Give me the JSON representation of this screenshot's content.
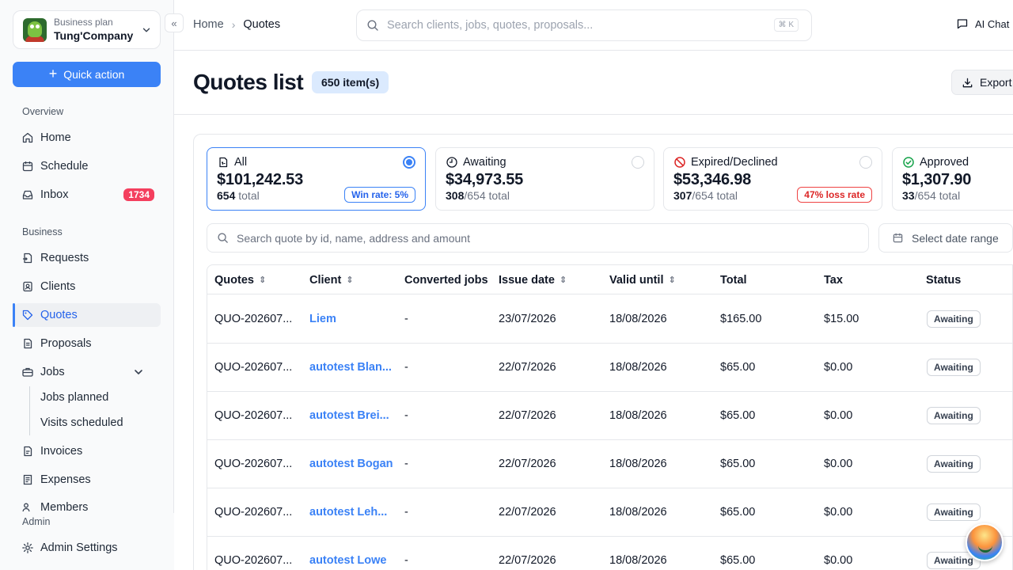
{
  "org": {
    "plan": "Business plan",
    "name": "Tung'Company"
  },
  "quick_action": "Quick action",
  "sidebar": {
    "overview_label": "Overview",
    "business_label": "Business",
    "admin_label": "Admin",
    "home": "Home",
    "schedule": "Schedule",
    "inbox": "Inbox",
    "inbox_count": "1734",
    "requests": "Requests",
    "clients": "Clients",
    "quotes": "Quotes",
    "proposals": "Proposals",
    "jobs": "Jobs",
    "jobs_planned": "Jobs planned",
    "visits_scheduled": "Visits scheduled",
    "invoices": "Invoices",
    "expenses": "Expenses",
    "members": "Members",
    "admin_settings": "Admin Settings"
  },
  "breadcrumb": {
    "home": "Home",
    "current": "Quotes"
  },
  "search": {
    "placeholder": "Search clients, jobs, quotes, proposals...",
    "shortcut": "⌘ K"
  },
  "ai_chat": "AI Chat",
  "page": {
    "title": "Quotes list",
    "count": "650 item(s)",
    "export": "Export"
  },
  "cards": [
    {
      "label": "All",
      "amount": "$101,242.53",
      "count": "654",
      "suffix": " total",
      "rate": "Win rate: 5%"
    },
    {
      "label": "Awaiting",
      "amount": "$34,973.55",
      "count": "308",
      "suffix": "/654 total"
    },
    {
      "label": "Expired/Declined",
      "amount": "$53,346.98",
      "count": "307",
      "suffix": "/654 total",
      "rate": "47% loss rate"
    },
    {
      "label": "Approved",
      "amount": "$1,307.90",
      "count": "33",
      "suffix": "/654 total"
    }
  ],
  "filters": {
    "search_placeholder": "Search quote by id, name, address and amount",
    "date_range": "Select date range"
  },
  "table": {
    "headers": {
      "quotes": "Quotes",
      "client": "Client",
      "converted": "Converted jobs",
      "issue": "Issue date",
      "valid": "Valid until",
      "total": "Total",
      "tax": "Tax",
      "status": "Status"
    },
    "rows": [
      {
        "id": "QUO-202607...",
        "client": "Liem",
        "converted": "-",
        "issue": "23/07/2026",
        "valid": "18/08/2026",
        "total": "$165.00",
        "tax": "$15.00",
        "status": "Awaiting"
      },
      {
        "id": "QUO-202607...",
        "client": "autotest Blan...",
        "converted": "-",
        "issue": "22/07/2026",
        "valid": "18/08/2026",
        "total": "$65.00",
        "tax": "$0.00",
        "status": "Awaiting"
      },
      {
        "id": "QUO-202607...",
        "client": "autotest Brei...",
        "converted": "-",
        "issue": "22/07/2026",
        "valid": "18/08/2026",
        "total": "$65.00",
        "tax": "$0.00",
        "status": "Awaiting"
      },
      {
        "id": "QUO-202607...",
        "client": "autotest Bogan",
        "converted": "-",
        "issue": "22/07/2026",
        "valid": "18/08/2026",
        "total": "$65.00",
        "tax": "$0.00",
        "status": "Awaiting"
      },
      {
        "id": "QUO-202607...",
        "client": "autotest Leh...",
        "converted": "-",
        "issue": "22/07/2026",
        "valid": "18/08/2026",
        "total": "$65.00",
        "tax": "$0.00",
        "status": "Awaiting"
      },
      {
        "id": "QUO-202607...",
        "client": "autotest Lowe",
        "converted": "-",
        "issue": "22/07/2026",
        "valid": "18/08/2026",
        "total": "$65.00",
        "tax": "$0.00",
        "status": "Awaiting"
      }
    ]
  },
  "colors": {
    "accent": "#3b82f6",
    "danger": "#dc2626",
    "success": "#16a34a"
  }
}
